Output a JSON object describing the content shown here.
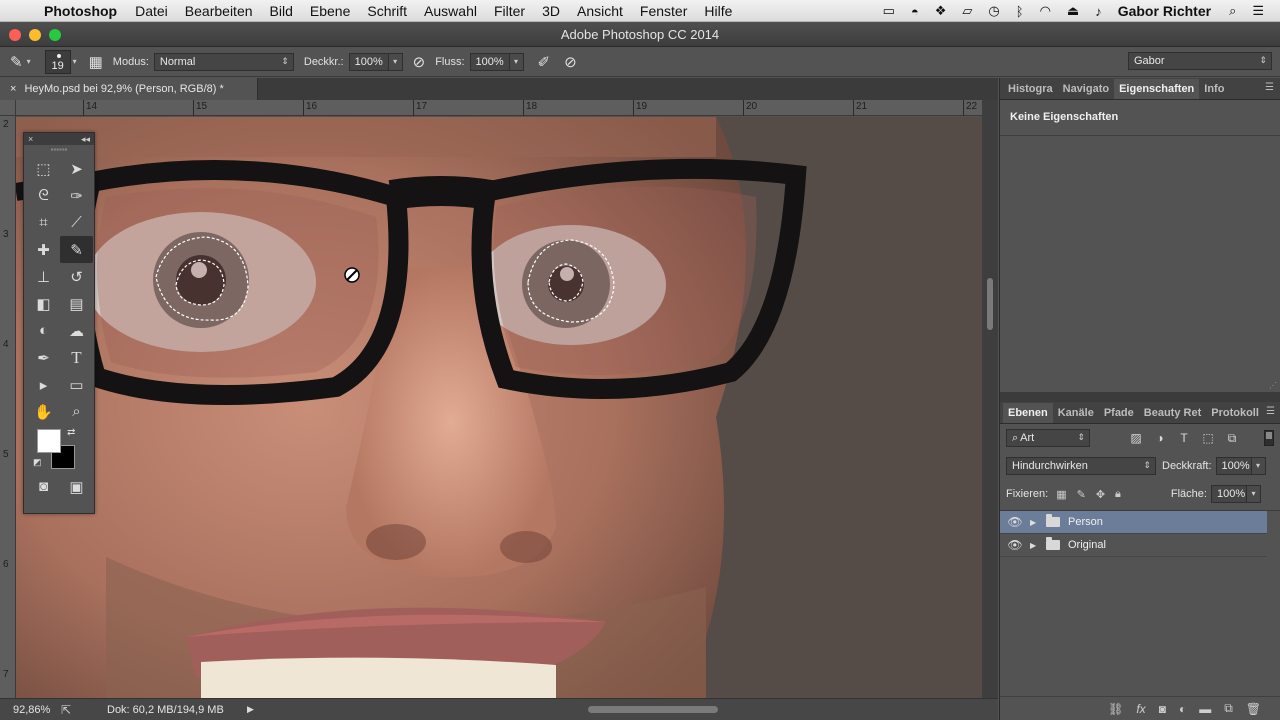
{
  "menubar": {
    "apple": "",
    "app": "Photoshop",
    "items": [
      "Datei",
      "Bearbeiten",
      "Bild",
      "Ebene",
      "Schrift",
      "Auswahl",
      "Filter",
      "3D",
      "Ansicht",
      "Fenster",
      "Hilfe"
    ],
    "user": "Gabor Richter"
  },
  "window": {
    "title": "Adobe Photoshop CC 2014"
  },
  "options": {
    "brush_size": "19",
    "mode_label": "Modus:",
    "mode_value": "Normal",
    "opacity_label": "Deckkr.:",
    "opacity_value": "100%",
    "flow_label": "Fluss:",
    "flow_value": "100%",
    "workspace": "Gabor"
  },
  "document": {
    "tab_title": "HeyMo.psd bei 92,9% (Person, RGB/8) *",
    "ruler_h": [
      "14",
      "15",
      "16",
      "17",
      "18",
      "19",
      "20",
      "21",
      "22"
    ],
    "ruler_v": [
      "2",
      "3",
      "4",
      "5",
      "6",
      "7"
    ]
  },
  "status": {
    "zoom": "92,86%",
    "doc": "Dok: 60,2 MB/194,9 MB"
  },
  "panels": {
    "top_tabs": [
      "Histogra",
      "Navigato",
      "Eigenschaften",
      "Info"
    ],
    "properties_text": "Keine Eigenschaften",
    "layer_tabs": [
      "Ebenen",
      "Kanäle",
      "Pfade",
      "Beauty Ret",
      "Protokoll"
    ],
    "filter_kind": "Art",
    "blend_mode": "Hindurchwirken",
    "opacity_label": "Deckkraft:",
    "opacity_value": "100%",
    "lock_label": "Fixieren:",
    "fill_label": "Fläche:",
    "fill_value": "100%",
    "layers": [
      {
        "name": "Person",
        "selected": true
      },
      {
        "name": "Original",
        "selected": false
      }
    ]
  },
  "colors": {
    "foreground": "#ffffff",
    "background": "#000000",
    "selection_highlight": "#6b7d99"
  }
}
